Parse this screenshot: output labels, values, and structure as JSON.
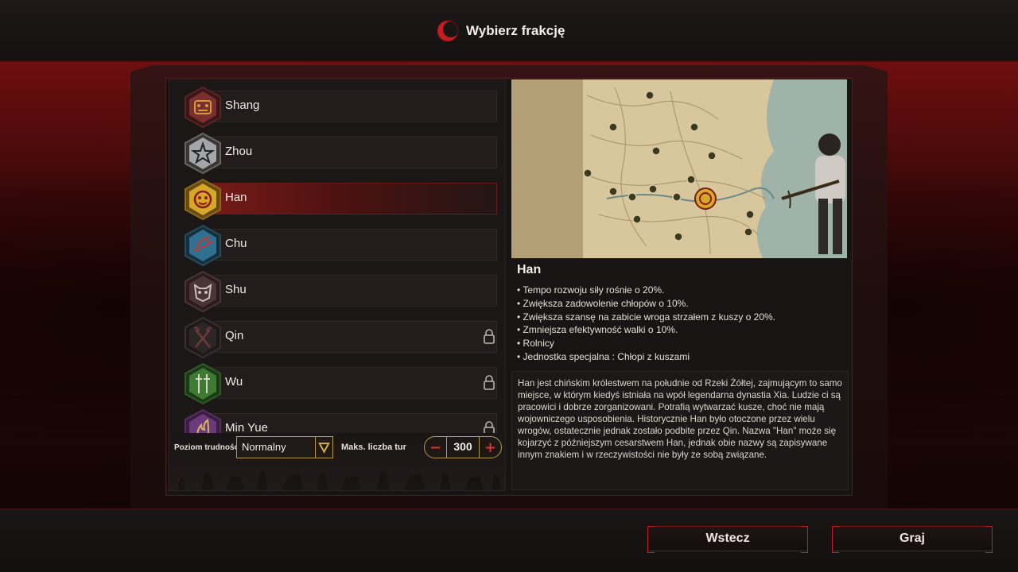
{
  "header": {
    "title": "Wybierz frakcję",
    "logo_icon": "red-crescent-logo-icon"
  },
  "factions": [
    {
      "name": "Shang",
      "icon": "bronze-mask-icon",
      "color": "#7a2e2e",
      "locked": false,
      "selected": false
    },
    {
      "name": "Zhou",
      "icon": "star-emblem-icon",
      "color": "#9b9ea0",
      "locked": false,
      "selected": false
    },
    {
      "name": "Han",
      "icon": "lion-mask-icon",
      "color": "#d6a829",
      "locked": false,
      "selected": true
    },
    {
      "name": "Chu",
      "icon": "phoenix-icon",
      "color": "#2f6f8f",
      "locked": false,
      "selected": false
    },
    {
      "name": "Shu",
      "icon": "demon-mask-icon",
      "color": "#4a3436",
      "locked": false,
      "selected": false
    },
    {
      "name": "Qin",
      "icon": "crossed-axes-icon",
      "color": "#2d2626",
      "locked": true,
      "selected": false
    },
    {
      "name": "Wu",
      "icon": "twin-swords-icon",
      "color": "#3f7a34",
      "locked": true,
      "selected": false
    },
    {
      "name": "Min Yue",
      "icon": "flame-emblem-icon",
      "color": "#6b3a7a",
      "locked": true,
      "selected": false
    }
  ],
  "settings": {
    "difficulty_label": "Poziom trudności",
    "difficulty_value": "Normalny",
    "turns_label": "Maks. liczba tur",
    "turns_value": "300"
  },
  "detail": {
    "title": "Han",
    "bullets": [
      "Tempo rozwoju siły rośnie o 20%.",
      "Zwiększa zadowolenie chłopów o 10%.",
      "Zwiększa szansę na zabicie wroga strzałem z kuszy o 20%.",
      "Zmniejsza efektywność walki o 10%.",
      "Rolnicy",
      "Jednostka specjalna : Chłopi z kuszami"
    ],
    "description": "Han jest chińskim królestwem na południe od Rzeki Żółtej, zajmującym to samo miejsce, w którym kiedyś istniała na wpół legendarna dynastia Xia. Ludzie ci są pracowici i dobrze zorganizowani. Potrafią wytwarzać kusze, choć nie mają wojowniczego usposobienia. Historycznie Han było otoczone przez wielu wrogów, ostatecznie jednak zostało podbite przez Qin. Nazwa \"Han\" może się kojarzyć z późniejszym cesarstwem Han, jednak obie nazwy są zapisywane innym znakiem i w rzeczywistości nie były ze sobą związane."
  },
  "footer": {
    "back_label": "Wstecz",
    "play_label": "Graj"
  },
  "colors": {
    "accent_red": "#c02024",
    "gold": "#b59a40",
    "selected_red": "#7a1b18"
  }
}
